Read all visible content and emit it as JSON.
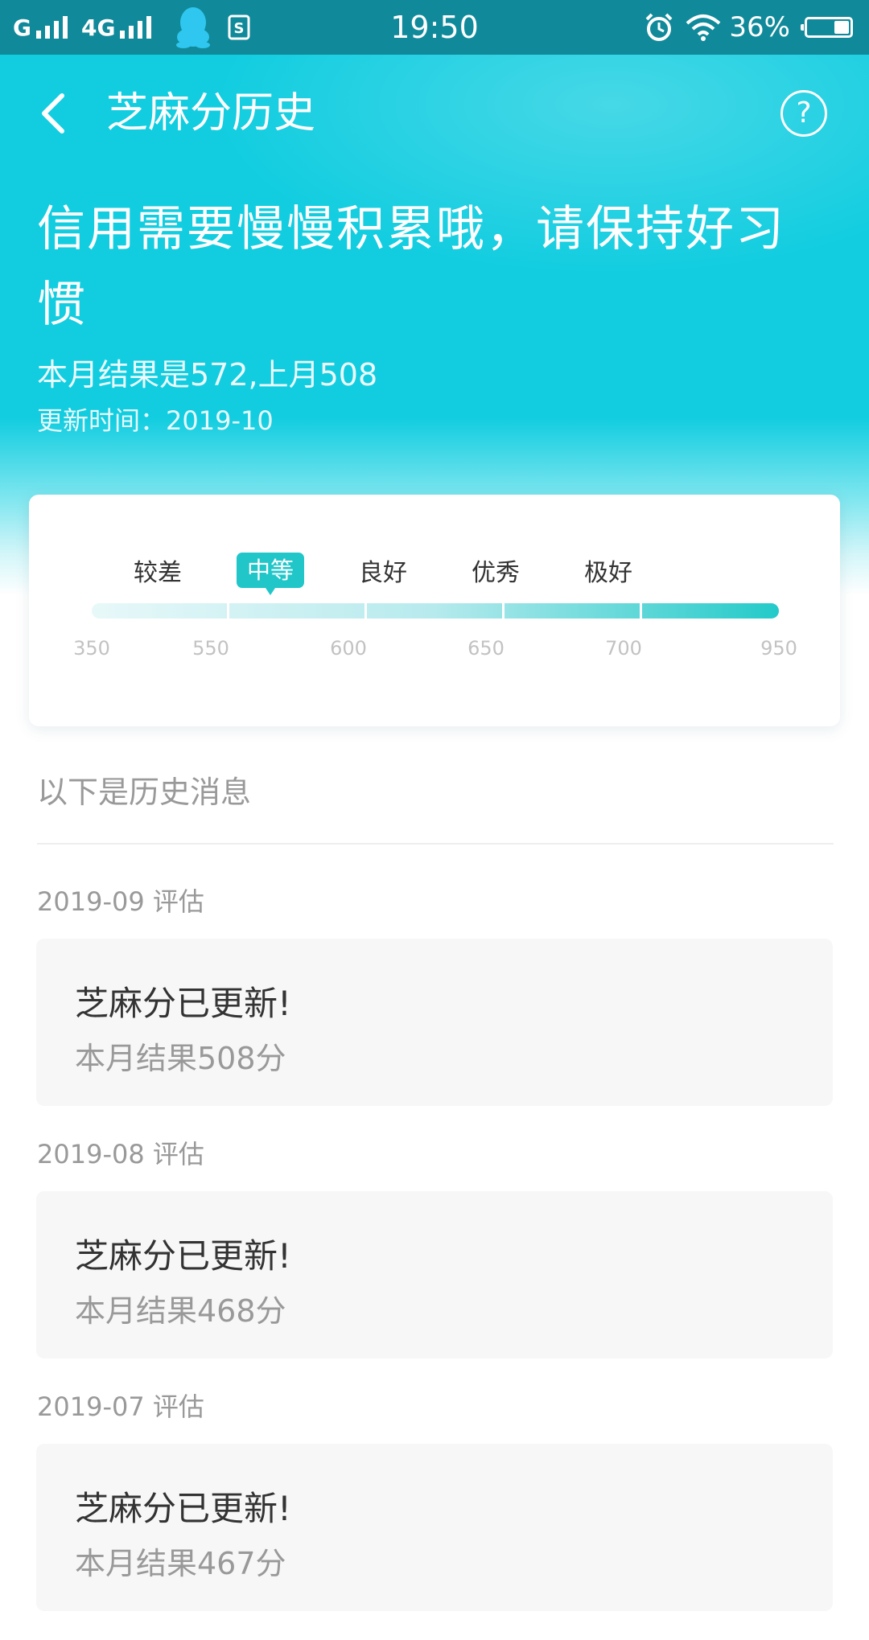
{
  "status_bar": {
    "carrier1": "G",
    "carrier2": "4G",
    "time": "19:50",
    "battery_percent": "36%",
    "battery_level": 0.36,
    "icons": [
      "signal-icon",
      "signal-icon",
      "qq-icon",
      "sim-icon",
      "alarm-icon",
      "wifi-icon",
      "battery-icon"
    ]
  },
  "nav": {
    "title": "芝麻分历史",
    "help_label": "?"
  },
  "header": {
    "headline": "信用需要慢慢积累哦，请保持好习惯",
    "summary": "本月结果是572,上月508",
    "updated": "更新时间：2019-10"
  },
  "score_card": {
    "levels": [
      "较差",
      "中等",
      "良好",
      "优秀",
      "极好"
    ],
    "active_level": "中等",
    "ticks": [
      "350",
      "550",
      "600",
      "650",
      "700",
      "950"
    ],
    "accent_color": "#21c6c9"
  },
  "history": {
    "heading": "以下是历史消息",
    "entries": [
      {
        "date": "2019-09 评估",
        "title": "芝麻分已更新!",
        "result": "本月结果508分"
      },
      {
        "date": "2019-08 评估",
        "title": "芝麻分已更新!",
        "result": "本月结果468分"
      },
      {
        "date": "2019-07 评估",
        "title": "芝麻分已更新!",
        "result": "本月结果467分"
      }
    ]
  },
  "theme": {
    "header_color": "#12cde0",
    "status_bar_color": "#108a9a"
  }
}
